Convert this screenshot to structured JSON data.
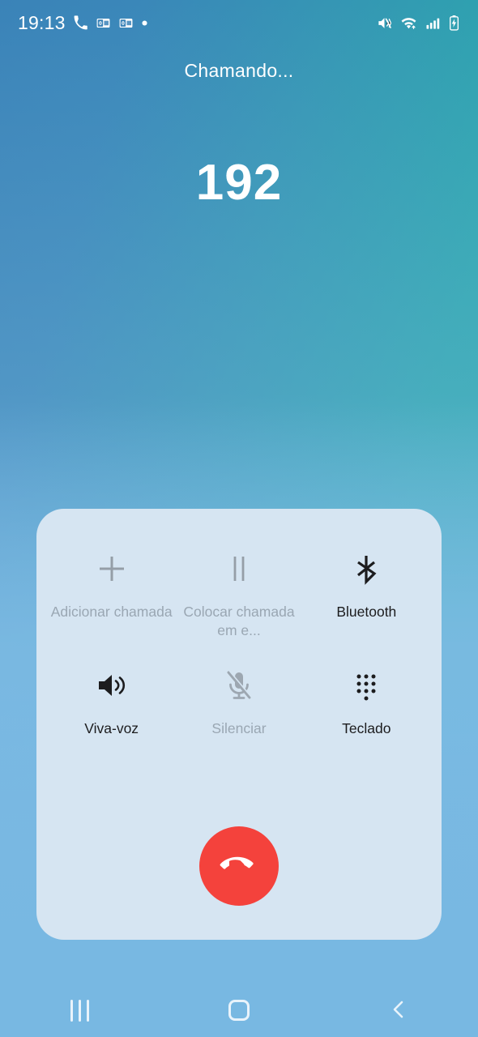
{
  "status_bar": {
    "time": "19:13",
    "left_icons": [
      {
        "name": "phone-call-icon",
        "label": "phone"
      },
      {
        "name": "outlook-mail-icon",
        "label": "outlook"
      },
      {
        "name": "outlook-mail-icon-2",
        "label": "outlook"
      },
      {
        "name": "more-notifications-dot-icon",
        "label": "more"
      }
    ],
    "right_icons": [
      {
        "name": "mute-vibrate-icon",
        "label": "sound off"
      },
      {
        "name": "wifi-icon",
        "label": "wi-fi"
      },
      {
        "name": "cellular-signal-icon",
        "label": "signal"
      },
      {
        "name": "battery-charging-icon",
        "label": "battery charging"
      }
    ]
  },
  "call": {
    "status_text": "Chamando...",
    "number": "192"
  },
  "controls": {
    "row_1": [
      {
        "id": "add-call",
        "label": "Adicionar chamada",
        "icon": "plus-icon",
        "enabled": false
      },
      {
        "id": "hold-call",
        "label": "Colocar chamada em e...",
        "icon": "pause-icon",
        "enabled": false
      },
      {
        "id": "bluetooth",
        "label": "Bluetooth",
        "icon": "bluetooth-icon",
        "enabled": true
      }
    ],
    "row_2": [
      {
        "id": "speaker",
        "label": "Viva-voz",
        "icon": "speaker-icon",
        "enabled": true
      },
      {
        "id": "mute",
        "label": "Silenciar",
        "icon": "microphone-muted-icon",
        "enabled": false
      },
      {
        "id": "keypad",
        "label": "Teclado",
        "icon": "dialpad-icon",
        "enabled": true
      }
    ],
    "end_call": {
      "id": "end-call",
      "icon": "end-call-handset-icon",
      "color": "#f4423c"
    }
  },
  "nav_bar": [
    {
      "id": "recents",
      "icon": "recents-icon"
    },
    {
      "id": "home",
      "icon": "home-icon"
    },
    {
      "id": "back",
      "icon": "back-chevron-icon"
    }
  ],
  "colors": {
    "gradient_top_left": "#3a83b8",
    "gradient_top_right": "#27a8ab",
    "gradient_bottom": "#78b8e2",
    "panel_background": "#d6e5f2",
    "end_call_red": "#f4423c",
    "label_enabled": "#1c1c1e",
    "label_disabled": "#9aa7b3"
  }
}
